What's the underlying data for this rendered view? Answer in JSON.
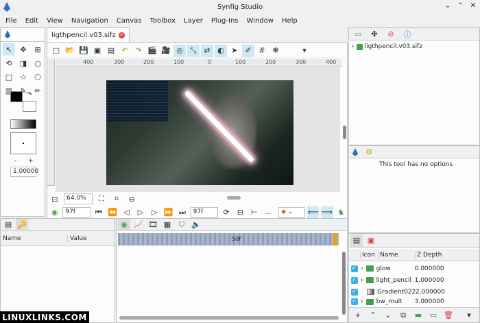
{
  "window": {
    "title": "Synfig Studio",
    "controls": [
      "⌄",
      "⌃",
      "✕"
    ]
  },
  "menu": [
    "File",
    "Edit",
    "View",
    "Navigation",
    "Canvas",
    "Toolbox",
    "Layer",
    "Plug-Ins",
    "Window",
    "Help"
  ],
  "canvas_tab": {
    "label": "ligthpencil.v03.sifz"
  },
  "ruler_labels": [
    "400",
    "300",
    "200",
    "100",
    "0",
    "100",
    "200",
    "300",
    "400"
  ],
  "toolbox": {
    "width_value": "1.00000"
  },
  "zoom": {
    "value": "64.0%"
  },
  "timebar": {
    "current_frame": "97f",
    "end_frame": "97f",
    "separator": "...",
    "timeline_mark": "50f"
  },
  "canvas_browser": {
    "file": "ligthpencil.v03.sifz"
  },
  "tool_options": {
    "message": "This tool has no options"
  },
  "params": {
    "col_name": "Name",
    "col_value": "Value"
  },
  "layers": {
    "headers": {
      "icon": "Icon",
      "name": "Name",
      "zdepth": "Z Depth"
    },
    "rows": [
      {
        "name": "glow",
        "zdepth": "0.000000",
        "kind": "folder"
      },
      {
        "name": "light_pencil",
        "zdepth": "1.000000",
        "kind": "folder"
      },
      {
        "name": "Gradient022",
        "zdepth": "2.000000",
        "kind": "gradient"
      },
      {
        "name": "bw_mult",
        "zdepth": "3.000000",
        "kind": "folder"
      }
    ]
  },
  "watermark": "LINUXLINKS.COM",
  "colors": {
    "accent": "#3daee9",
    "folder": "#4b9c4c",
    "close": "#e0393e"
  }
}
